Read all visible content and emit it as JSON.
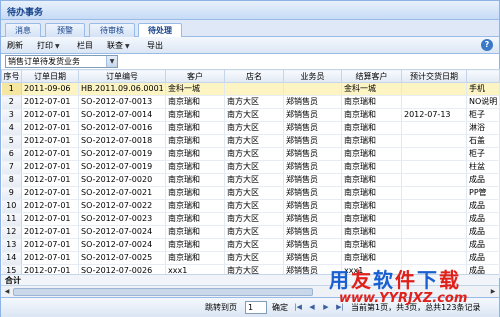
{
  "window": {
    "title": "待办事务"
  },
  "tabs": [
    {
      "label": "消息"
    },
    {
      "label": "预警"
    },
    {
      "label": "待审核"
    },
    {
      "label": "待处理"
    }
  ],
  "toolbar": {
    "refresh": "刷新",
    "print": "打印",
    "columns": "栏目",
    "link": "联查",
    "export": "导出"
  },
  "filter": {
    "selected": "销售订单待发货业务"
  },
  "table": {
    "headers": [
      "序号",
      "订单日期",
      "订单编号",
      "客户",
      "店名",
      "业务员",
      "结算客户",
      "预计交货日期",
      ""
    ],
    "rows": [
      [
        "1",
        "2011-09-06",
        "HB.2011.09.06.0001",
        "金科一城",
        "",
        "",
        "金科一城",
        "",
        "手机"
      ],
      [
        "2",
        "2012-07-01",
        "SO-2012-07-0013",
        "南京瑞和",
        "南方大区",
        "郑销售员",
        "南京瑞和",
        "",
        "NO说明"
      ],
      [
        "3",
        "2012-07-01",
        "SO-2012-07-0014",
        "南京瑞和",
        "南方大区",
        "郑销售员",
        "南京瑞和",
        "2012-07-13",
        "柜子"
      ],
      [
        "4",
        "2012-07-01",
        "SO-2012-07-0016",
        "南京瑞和",
        "南方大区",
        "郑销售员",
        "南京瑞和",
        "",
        "淋浴"
      ],
      [
        "5",
        "2012-07-01",
        "SO-2012-07-0018",
        "南京瑞和",
        "南方大区",
        "郑销售员",
        "南京瑞和",
        "",
        "石盖"
      ],
      [
        "6",
        "2012-07-01",
        "SO-2012-07-0019",
        "南京瑞和",
        "南方大区",
        "郑销售员",
        "南京瑞和",
        "",
        "柜子"
      ],
      [
        "7",
        "2012-07-01",
        "SO-2012-07-0019",
        "南京瑞和",
        "南方大区",
        "郑销售员",
        "南京瑞和",
        "",
        "柱盆"
      ],
      [
        "8",
        "2012-07-01",
        "SO-2012-07-0020",
        "南京瑞和",
        "南方大区",
        "郑销售员",
        "南京瑞和",
        "",
        "成品"
      ],
      [
        "9",
        "2012-07-01",
        "SO-2012-07-0021",
        "南京瑞和",
        "南方大区",
        "郑销售员",
        "南京瑞和",
        "",
        "PP管"
      ],
      [
        "10",
        "2012-07-01",
        "SO-2012-07-0022",
        "南京瑞和",
        "南方大区",
        "郑销售员",
        "南京瑞和",
        "",
        "成品"
      ],
      [
        "11",
        "2012-07-01",
        "SO-2012-07-0023",
        "南京瑞和",
        "南方大区",
        "郑销售员",
        "南京瑞和",
        "",
        "成品"
      ],
      [
        "12",
        "2012-07-01",
        "SO-2012-07-0024",
        "南京瑞和",
        "南方大区",
        "郑销售员",
        "南京瑞和",
        "",
        "成品"
      ],
      [
        "13",
        "2012-07-01",
        "SO-2012-07-0024",
        "南京瑞和",
        "南方大区",
        "郑销售员",
        "南京瑞和",
        "",
        "成品"
      ],
      [
        "14",
        "2012-07-01",
        "SO-2012-07-0025",
        "南京瑞和",
        "南方大区",
        "郑销售员",
        "南京瑞和",
        "",
        "成品"
      ],
      [
        "15",
        "2012-07-01",
        "SO-2012-07-0026",
        "xxx1",
        "南方大区",
        "郑销售员",
        "xxx1",
        "",
        "成品"
      ]
    ]
  },
  "total": {
    "label": "合计"
  },
  "pager": {
    "goto_label": "跳转到页",
    "page_value": "1",
    "confirm": "确定",
    "status": "当前第1页，共3页，总共123条记录"
  },
  "watermark": {
    "chars": [
      "用",
      "友",
      "软",
      "件",
      "下",
      "载"
    ],
    "colors": [
      "#1a5fcf",
      "#e0201b",
      "#1a5fcf",
      "#e0201b",
      "#1a5fcf",
      "#e0201b"
    ],
    "url": "www.YYRJXZ.com"
  }
}
